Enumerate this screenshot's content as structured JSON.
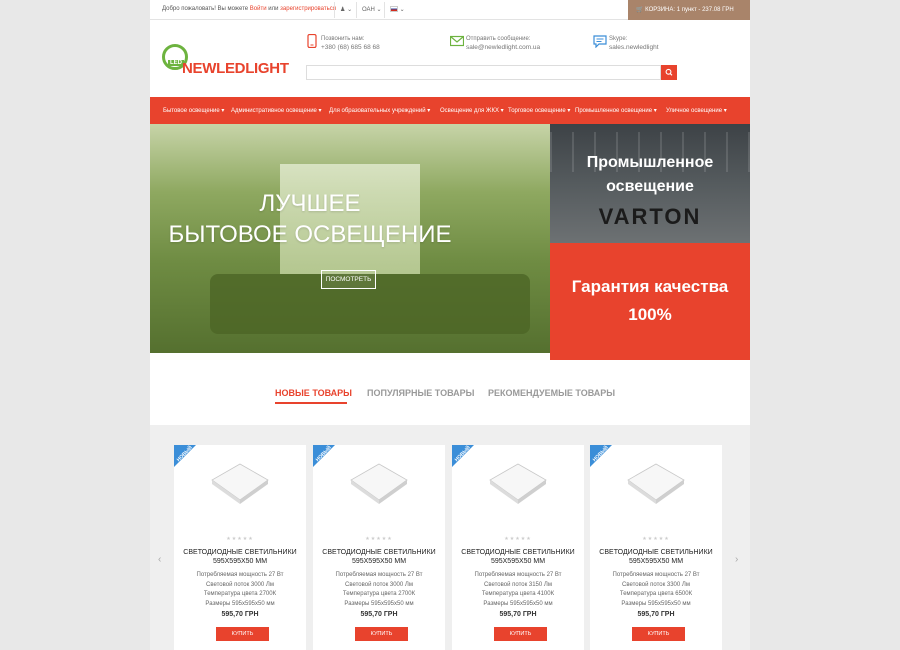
{
  "topbar": {
    "welcome": "Добро пожаловать! Вы можете",
    "login": "Войти",
    "or": "или",
    "register": "зарегистрироваться",
    "currency": "ОАН",
    "cart": "КОРЗИНА: 1 пункт - 237.08 ГРН"
  },
  "header": {
    "logo_led": "LED",
    "logo_text": "NEWLEDLIGHT",
    "contacts": [
      {
        "label": "Позвонить нам:",
        "value": "+380 (68) 685 68 68",
        "icon": "phone-icon"
      },
      {
        "label": "Отправить сообщение:",
        "value": "sale@newledlight.com.ua",
        "icon": "mail-icon"
      },
      {
        "label": "Skype:",
        "value": "sales.newledlight",
        "icon": "skype-icon"
      }
    ],
    "search_placeholder": ""
  },
  "nav": {
    "items": [
      "Бытовое освещение ▾",
      "Административное освещение ▾",
      "Для образовательных учреждений ▾",
      "Освещение для ЖКХ ▾",
      "Торговое освещение ▾",
      "Промышленное освещение ▾",
      "Уличное освещение ▾"
    ]
  },
  "hero": {
    "line1": "ЛУЧШЕЕ",
    "line2": "БЫТОВОЕ ОСВЕЩЕНИЕ",
    "button": "ПОСМОТРЕТЬ"
  },
  "side_banner_top": {
    "line1": "Промышленное",
    "line2": "освещение",
    "brand": "VARTON"
  },
  "side_banner_bottom": {
    "line1": "Гарантия качества",
    "line2": "100%"
  },
  "tabs": [
    "НОВЫЕ ТОВАРЫ",
    "ПОПУЛЯРНЫЕ ТОВАРЫ",
    "РЕКОМЕНДУЕМЫЕ ТОВАРЫ"
  ],
  "carousel": {
    "prev": "‹",
    "next": "›"
  },
  "products": [
    {
      "badge": "НОВЫЙ",
      "stars": "★★★★★",
      "title1": "СВЕТОДИОДНЫЕ СВЕТИЛЬНИКИ",
      "title2": "595Х595Х50 ММ",
      "desc1": "Потребляемая мощность 27 Вт",
      "desc2": "Световой поток 3000 Лм",
      "desc3": "Температура цвета 2700К",
      "desc4": "Размеры 595х595х50 мм",
      "price": "595,70 ГРН",
      "buy": "КУПИТЬ"
    },
    {
      "badge": "НОВЫЙ",
      "stars": "★★★★★",
      "title1": "СВЕТОДИОДНЫЕ СВЕТИЛЬНИКИ",
      "title2": "595Х595Х50 ММ",
      "desc1": "Потребляемая мощность 27 Вт",
      "desc2": "Световой поток 3000 Лм",
      "desc3": "Температура цвета 2700К",
      "desc4": "Размеры 595х595х50 мм",
      "price": "595,70 ГРН",
      "buy": "КУПИТЬ"
    },
    {
      "badge": "НОВЫЙ",
      "stars": "★★★★★",
      "title1": "СВЕТОДИОДНЫЕ СВЕТИЛЬНИКИ",
      "title2": "595Х595Х50 ММ",
      "desc1": "Потребляемая мощность 27 Вт",
      "desc2": "Световой поток 3150 Лм",
      "desc3": "Температура цвета 4100К",
      "desc4": "Размеры 595х595х50 мм",
      "price": "595,70 ГРН",
      "buy": "КУПИТЬ"
    },
    {
      "badge": "НОВЫЙ",
      "stars": "★★★★★",
      "title1": "СВЕТОДИОДНЫЕ СВЕТИЛЬНИКИ",
      "title2": "595Х595Х50 ММ",
      "desc1": "Потребляемая мощность 27 Вт",
      "desc2": "Световой поток 3300 Лм",
      "desc3": "Температура цвета 6500К",
      "desc4": "Размеры 595х595х50 мм",
      "price": "595,70 ГРН",
      "buy": "КУПИТЬ"
    }
  ],
  "colors": {
    "accent": "#e8432d",
    "badge": "#3b8ed8",
    "logo_green": "#6db33f",
    "cart_bg": "#a9846a"
  }
}
